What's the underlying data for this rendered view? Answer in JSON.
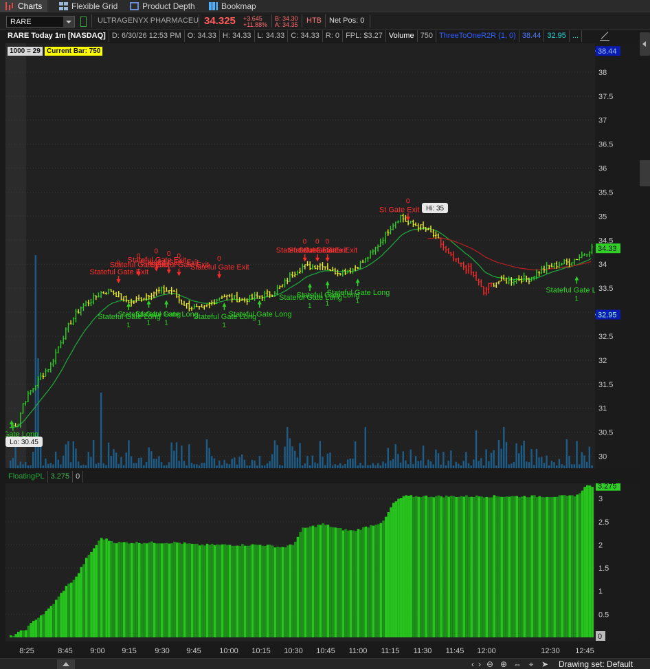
{
  "tabs": [
    {
      "label": "Charts",
      "icon": "bar-chart-icon",
      "active": true
    },
    {
      "label": "Flexible Grid",
      "icon": "grid-icon",
      "active": false
    },
    {
      "label": "Product Depth",
      "icon": "depth-icon",
      "active": false
    },
    {
      "label": "Bookmap",
      "icon": "bookmap-icon",
      "active": false
    }
  ],
  "header": {
    "symbol": "RARE",
    "company": "ULTRAGENYX PHARMACEU",
    "last": "34.325",
    "change": "+3.645",
    "change_pct": "+11.88%",
    "bid": "B: 34.30",
    "ask": "A: 34.35",
    "htb": "HTB",
    "net_pos": "Net Pos: 0"
  },
  "infobar": {
    "title": "RARE Today 1m [NASDAQ]",
    "date": "D: 6/30/26 12:53 PM",
    "open": "O: 34.33",
    "high": "H: 34.33",
    "low": "L: 34.33",
    "close": "C: 34.33",
    "range": "R: 0",
    "fpl": "FPL: $3.27",
    "volume_label": "Volume",
    "volume": "750",
    "study": "ThreeToOneR2R (1, 0)",
    "study_v1": "38.44",
    "study_v2": "32.95",
    "more": "..."
  },
  "badges": {
    "ratio": "1000 = 29",
    "current_bar": "Current Bar: 750"
  },
  "colors": {
    "up": "#2fd126",
    "neutral": "#f0f020",
    "down": "#ff2a2a",
    "ema": "#1fa33a",
    "vwap": "#b02020",
    "volume": "#1d5d8a",
    "pl_bar": "#1e8f1a",
    "pl_bar_bright": "#27c41e",
    "price_tag": "#2fd126"
  },
  "price_axis": {
    "ticks": [
      "38",
      "37.5",
      "37",
      "36.5",
      "36",
      "35.5",
      "35",
      "34.5",
      "34",
      "33.5",
      "33",
      "32.5",
      "32",
      "31.5",
      "31",
      "30.5",
      "30"
    ],
    "tag_top": "38.44",
    "tag_last": "34.33",
    "tag_bottom": "32.95"
  },
  "pl_axis": {
    "ticks": [
      "3",
      "2.5",
      "2",
      "1.5",
      "1",
      "0.5"
    ],
    "tag_value": "3.275",
    "tag_zero": "0"
  },
  "time_axis": [
    "8:25",
    "8:45",
    "9:00",
    "9:15",
    "9:30",
    "9:45",
    "10:00",
    "10:15",
    "10:30",
    "10:45",
    "11:00",
    "11:15",
    "11:30",
    "11:45",
    "12:00",
    "12:30",
    "12:45"
  ],
  "bubbles": {
    "hi": "Hi: 35",
    "lo": "Lo: 30.45"
  },
  "signals": {
    "long_label": "Stateful Gate Long",
    "exit_label": "Stateful Gate Exit",
    "long_count": "1",
    "exit_count": "0",
    "long_truncated_left": "tateful Gate Long",
    "long_truncated_right": "Stateful Gate L",
    "exit_truncated": "St      Gate Exit",
    "longs": [
      {
        "price": 30.75,
        "t": 0.5,
        "label": "tateful Gate Long"
      },
      {
        "price": 33.2,
        "t": 47,
        "label": "Stateful Gate Long"
      },
      {
        "price": 33.25,
        "t": 55,
        "label": "Stateful Gate Long"
      },
      {
        "price": 33.25,
        "t": 62,
        "label": "Stateful Gate Long"
      },
      {
        "price": 33.2,
        "t": 85,
        "label": "Stateful Gate Long"
      },
      {
        "price": 33.25,
        "t": 99,
        "label": "Stateful Gate Long"
      },
      {
        "price": 33.6,
        "t": 119,
        "label": "Stateful Gate Long"
      },
      {
        "price": 33.65,
        "t": 126,
        "label": "Stateful Gate Long"
      },
      {
        "price": 33.7,
        "t": 138,
        "label": "Stateful Gate Long"
      },
      {
        "price": 33.75,
        "t": 225,
        "label": "Stateful Gate L"
      }
    ],
    "exits": [
      {
        "price": 33.6,
        "t": 43,
        "label": "Stateful Gate Exit"
      },
      {
        "price": 33.75,
        "t": 51,
        "label": "Stateful Gate Exit"
      },
      {
        "price": 33.85,
        "t": 58,
        "label": "Stateful Gate Exit"
      },
      {
        "price": 33.8,
        "t": 63,
        "label": "Stateful Gate Exit"
      },
      {
        "price": 33.75,
        "t": 67,
        "label": "Stateful Gate Exit"
      },
      {
        "price": 33.7,
        "t": 83,
        "label": "Stateful Gate Exit"
      },
      {
        "price": 34.05,
        "t": 117,
        "label": "Stateful Gate Exit"
      },
      {
        "price": 34.05,
        "t": 122,
        "label": "Stateful Gate Exit"
      },
      {
        "price": 34.05,
        "t": 126,
        "label": "Stateful Gate Exit"
      },
      {
        "price": 34.9,
        "t": 158,
        "label": "St      Gate Exit"
      }
    ]
  },
  "pl_panel": {
    "name": "FloatingPL",
    "value": "3.275",
    "zero": "0"
  },
  "bottombar": {
    "drawing_set": "Drawing set: Default"
  },
  "chart_data": {
    "type": "bar",
    "title": "RARE Today 1m [NASDAQ]",
    "ylim": [
      29.75,
      38.6
    ],
    "ylabel": "",
    "xlabel": "",
    "pl_ylim": [
      0,
      3.3
    ],
    "pl_markers": [
      [
        0,
        0.02
      ],
      [
        6,
        0.18
      ],
      [
        10,
        0.4
      ],
      [
        14,
        0.55
      ],
      [
        18,
        0.8
      ],
      [
        22,
        1.1
      ],
      [
        26,
        1.3
      ],
      [
        30,
        1.7
      ],
      [
        36,
        2.15
      ],
      [
        42,
        2.05
      ],
      [
        48,
        2.05
      ],
      [
        56,
        2.05
      ],
      [
        62,
        2.05
      ],
      [
        66,
        2.05
      ],
      [
        74,
        2.0
      ],
      [
        90,
        2.0
      ],
      [
        100,
        2.0
      ],
      [
        108,
        1.95
      ],
      [
        112,
        2.0
      ],
      [
        116,
        2.35
      ],
      [
        120,
        2.4
      ],
      [
        124,
        2.45
      ],
      [
        130,
        2.35
      ],
      [
        136,
        2.3
      ],
      [
        148,
        2.5
      ],
      [
        152,
        2.9
      ],
      [
        156,
        3.05
      ],
      [
        160,
        3.05
      ],
      [
        170,
        3.05
      ],
      [
        180,
        3.05
      ],
      [
        200,
        3.05
      ],
      [
        216,
        3.05
      ],
      [
        222,
        3.05
      ],
      [
        226,
        3.1
      ],
      [
        228,
        3.275
      ]
    ]
  }
}
